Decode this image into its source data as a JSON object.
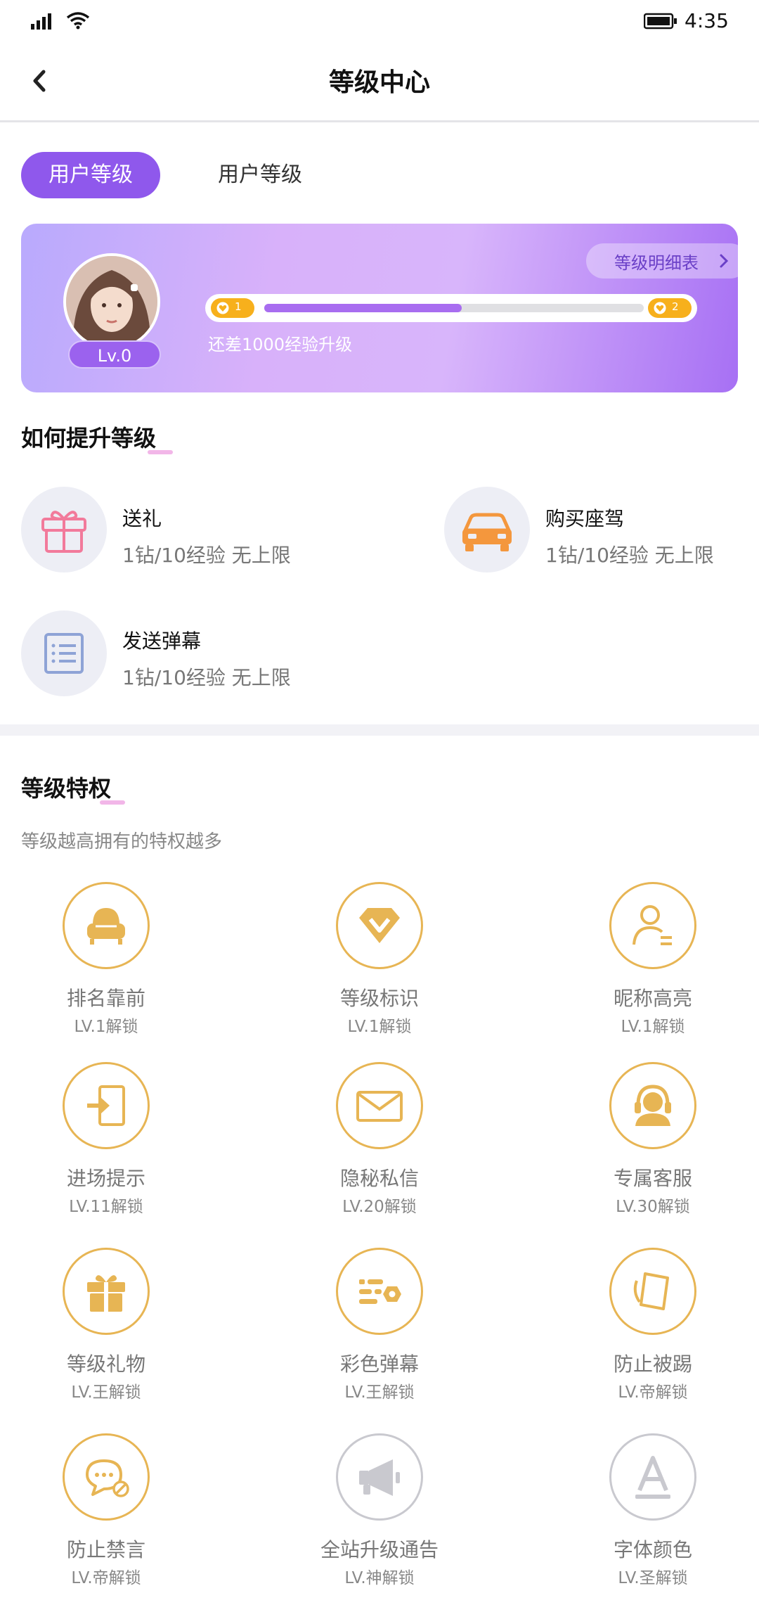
{
  "status": {
    "time": "4:35"
  },
  "nav": {
    "title": "等级中心"
  },
  "tabs": [
    {
      "label": "用户等级"
    },
    {
      "label": "用户等级"
    }
  ],
  "level_card": {
    "level": "Lv.0",
    "detail_label": "等级明细表",
    "current_level": "1",
    "next_level": "2",
    "progress": 0.52,
    "need_text": "还差1000经验升级"
  },
  "how_to": {
    "title": "如何提升等级",
    "items": [
      {
        "name": "送礼",
        "desc": "1钻/10经验   无上限",
        "icon": "gift-icon"
      },
      {
        "name": "购买座驾",
        "desc": "1钻/10经验   无上限",
        "icon": "car-icon"
      },
      {
        "name": "发送弹幕",
        "desc": "1钻/10经验   无上限",
        "icon": "list-icon"
      }
    ]
  },
  "privileges": {
    "title": "等级特权",
    "subtitle": "等级越高拥有的特权越多",
    "items": [
      {
        "name": "排名靠前",
        "unlock": "LV.1解锁",
        "icon": "sofa-icon"
      },
      {
        "name": "等级标识",
        "unlock": "LV.1解锁",
        "icon": "diamond-v-icon"
      },
      {
        "name": "昵称高亮",
        "unlock": "LV.1解锁",
        "icon": "user-highlight-icon"
      },
      {
        "name": "进场提示",
        "unlock": "LV.11解锁",
        "icon": "enter-icon"
      },
      {
        "name": "隐秘私信",
        "unlock": "LV.20解锁",
        "icon": "mail-icon"
      },
      {
        "name": "专属客服",
        "unlock": "LV.30解锁",
        "icon": "headset-icon"
      },
      {
        "name": "等级礼物",
        "unlock": "LV.王解锁",
        "icon": "gift-box-icon"
      },
      {
        "name": "彩色弹幕",
        "unlock": "LV.王解锁",
        "icon": "color-danmaku-icon"
      },
      {
        "name": "防止被踢",
        "unlock": "LV.帝解锁",
        "icon": "card-icon"
      },
      {
        "name": "防止禁言",
        "unlock": "LV.帝解锁",
        "icon": "no-mute-icon"
      },
      {
        "name": "全站升级通告",
        "unlock": "LV.神解锁",
        "icon": "megaphone-icon"
      },
      {
        "name": "字体颜色",
        "unlock": "LV.圣解锁",
        "icon": "font-color-icon"
      }
    ]
  }
}
